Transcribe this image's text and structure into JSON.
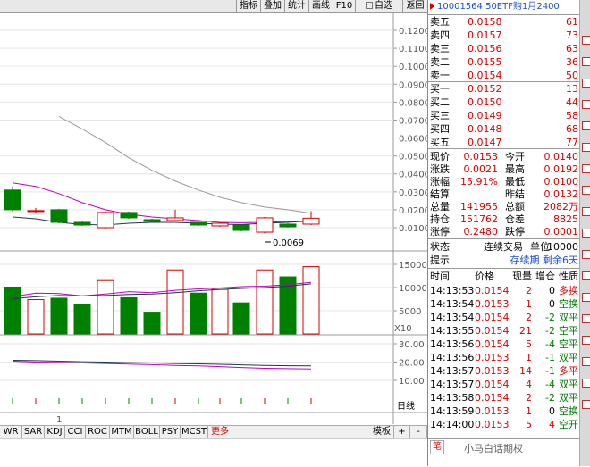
{
  "toolbar": {
    "buttons": [
      "指标",
      "叠加",
      "统计",
      "画线",
      "F10",
      "自选",
      "返回"
    ]
  },
  "chart_data": {
    "type": "candlestick",
    "price_axis": {
      "ticks": [
        "0.1200",
        "0.1100",
        "0.1000",
        "0.0900",
        "0.0800",
        "0.0700",
        "0.0600",
        "0.0500",
        "0.0400",
        "0.0300",
        "0.0200",
        "0.0100"
      ]
    },
    "low_label": "0.0069",
    "volume_axis": {
      "ticks": [
        "15000",
        "10000",
        "5000"
      ],
      "unit": "X10"
    },
    "indicator_axis": {
      "ticks": [
        "30.00",
        "20.00",
        "10.00"
      ]
    },
    "x_label": "1",
    "candles": [
      {
        "o": 0.031,
        "c": 0.02,
        "h": 0.033,
        "l": 0.019
      },
      {
        "o": 0.019,
        "c": 0.0195,
        "h": 0.021,
        "l": 0.018
      },
      {
        "o": 0.02,
        "c": 0.013,
        "h": 0.0205,
        "l": 0.0125
      },
      {
        "o": 0.013,
        "c": 0.0115,
        "h": 0.0135,
        "l": 0.011
      },
      {
        "o": 0.01,
        "c": 0.0185,
        "h": 0.019,
        "l": 0.0095
      },
      {
        "o": 0.0185,
        "c": 0.0155,
        "h": 0.019,
        "l": 0.015
      },
      {
        "o": 0.0145,
        "c": 0.0135,
        "h": 0.015,
        "l": 0.013
      },
      {
        "o": 0.014,
        "c": 0.0155,
        "h": 0.02,
        "l": 0.0135
      },
      {
        "o": 0.013,
        "c": 0.0115,
        "h": 0.0135,
        "l": 0.011
      },
      {
        "o": 0.011,
        "c": 0.0125,
        "h": 0.013,
        "l": 0.0105
      },
      {
        "o": 0.0115,
        "c": 0.0085,
        "h": 0.012,
        "l": 0.008
      },
      {
        "o": 0.0075,
        "c": 0.0155,
        "h": 0.016,
        "l": 0.0069
      },
      {
        "o": 0.012,
        "c": 0.0105,
        "h": 0.0125,
        "l": 0.01
      },
      {
        "o": 0.012,
        "c": 0.0153,
        "h": 0.0192,
        "l": 0.0115
      }
    ],
    "volumes": [
      10100,
      7400,
      7700,
      6400,
      11500,
      7800,
      4700,
      13800,
      8800,
      9600,
      6700,
      13800,
      12300,
      14500
    ],
    "ma_gray": [
      null,
      null,
      0.072,
      0.065,
      0.0575,
      0.049,
      0.042,
      0.036,
      0.031,
      0.027,
      0.024,
      0.0215,
      0.02,
      0.018
    ],
    "ma_purple": [
      0.035,
      0.033,
      0.029,
      0.024,
      0.02,
      0.0175,
      0.016,
      0.015,
      0.014,
      0.013,
      0.0128,
      0.013,
      0.0135,
      0.014
    ],
    "ma_dark": [
      0.016,
      0.015,
      0.013,
      0.0118,
      0.0115,
      0.0125,
      0.013,
      0.013,
      0.0125,
      0.012,
      0.0118,
      0.0125,
      0.013,
      0.0138
    ],
    "vol_ma1": [
      8000,
      8800,
      8700,
      8200,
      8600,
      9100,
      8900,
      9400,
      9700,
      9900,
      10200,
      10300,
      10600,
      11100
    ],
    "vol_ma2": [
      7600,
      8000,
      8300,
      8200,
      8300,
      8500,
      8600,
      8900,
      9300,
      9600,
      9800,
      10000,
      10300,
      10800
    ],
    "ind_purple": [
      20.5,
      20.0,
      19.8,
      19.5,
      19.2,
      18.9,
      18.6,
      18.2,
      17.9,
      17.5,
      17.0,
      16.6,
      16.4,
      16.2
    ],
    "ind_dark": [
      21.0,
      20.8,
      20.5,
      20.2,
      20.0,
      19.7,
      19.5,
      19.2,
      19.0,
      18.8,
      18.5,
      18.2,
      18.0,
      17.9
    ]
  },
  "tabs": [
    "WR",
    "SAR",
    "KDJ",
    "CCI",
    "ROC",
    "MTM",
    "BOLL",
    "PSY",
    "MCST",
    "更多"
  ],
  "tabs_right": [
    "模板",
    "+",
    "-"
  ],
  "panel": {
    "title": "10001564 50ETF购1月2400",
    "asks": [
      {
        "label": "卖五",
        "price": "0.0158",
        "vol": "61"
      },
      {
        "label": "卖四",
        "price": "0.0157",
        "vol": "73"
      },
      {
        "label": "卖三",
        "price": "0.0156",
        "vol": "63"
      },
      {
        "label": "卖二",
        "price": "0.0155",
        "vol": "36"
      },
      {
        "label": "卖一",
        "price": "0.0154",
        "vol": "50"
      }
    ],
    "bids": [
      {
        "label": "买一",
        "price": "0.0152",
        "vol": "13"
      },
      {
        "label": "买二",
        "price": "0.0150",
        "vol": "44"
      },
      {
        "label": "买三",
        "price": "0.0149",
        "vol": "58"
      },
      {
        "label": "买四",
        "price": "0.0148",
        "vol": "68"
      },
      {
        "label": "买五",
        "price": "0.0147",
        "vol": "77"
      }
    ],
    "quote": [
      {
        "l1": "现价",
        "v1": "0.0153",
        "l2": "今开",
        "v2": "0.0140"
      },
      {
        "l1": "涨跌",
        "v1": "0.0021",
        "l2": "最高",
        "v2": "0.0192"
      },
      {
        "l1": "涨幅",
        "v1": "15.91%",
        "l2": "最低",
        "v2": "0.0100"
      },
      {
        "l1": "结算",
        "v1": "",
        "l2": "昨结",
        "v2": "0.0132"
      },
      {
        "l1": "总量",
        "v1": "141955",
        "l2": "总额",
        "v2": "2082万"
      },
      {
        "l1": "持仓",
        "v1": "151762",
        "l2": "仓差",
        "v2": "8825"
      },
      {
        "l1": "涨停",
        "v1": "0.2480",
        "l2": "跌停",
        "v2": "0.0001"
      }
    ],
    "status": {
      "label": "状态",
      "value": "连续交易",
      "unit_label": "单位",
      "unit": "10000"
    },
    "hint": {
      "label": "提示",
      "value": "存续期 剩余6天"
    },
    "trades_header": [
      "时间",
      "价格",
      "现量",
      "增仓",
      "性质"
    ],
    "trades": [
      {
        "t": "14:13:53",
        "p": "0.0154",
        "v": "2",
        "d": "0",
        "n": "多换"
      },
      {
        "t": "14:13:54",
        "p": "0.0153",
        "v": "1",
        "d": "0",
        "n": "空换"
      },
      {
        "t": "14:13:54",
        "p": "0.0154",
        "v": "2",
        "d": "-2",
        "n": "双平"
      },
      {
        "t": "14:13:55",
        "p": "0.0154",
        "v": "21",
        "d": "-2",
        "n": "空平"
      },
      {
        "t": "14:13:56",
        "p": "0.0154",
        "v": "5",
        "d": "-4",
        "n": "空平"
      },
      {
        "t": "14:13:56",
        "p": "0.0153",
        "v": "1",
        "d": "-1",
        "n": "双平"
      },
      {
        "t": "14:13:57",
        "p": "0.0153",
        "v": "14",
        "d": "-1",
        "n": "多平"
      },
      {
        "t": "14:13:57",
        "p": "0.0154",
        "v": "4",
        "d": "-4",
        "n": "双平"
      },
      {
        "t": "14:13:58",
        "p": "0.0154",
        "v": "2",
        "d": "-2",
        "n": "双平"
      },
      {
        "t": "14:13:59",
        "p": "0.0153",
        "v": "1",
        "d": "0",
        "n": "空换"
      },
      {
        "t": "14:14:00",
        "p": "0.0153",
        "v": "5",
        "d": "4",
        "n": "空开"
      }
    ],
    "bottom_tab": "笔",
    "watermark": "小马白话期权"
  },
  "colors": {
    "up": "#d60000",
    "down": "#008000",
    "ma_gray": "#999999",
    "ma_purple": "#c000c0",
    "ma_dark": "#223355"
  }
}
